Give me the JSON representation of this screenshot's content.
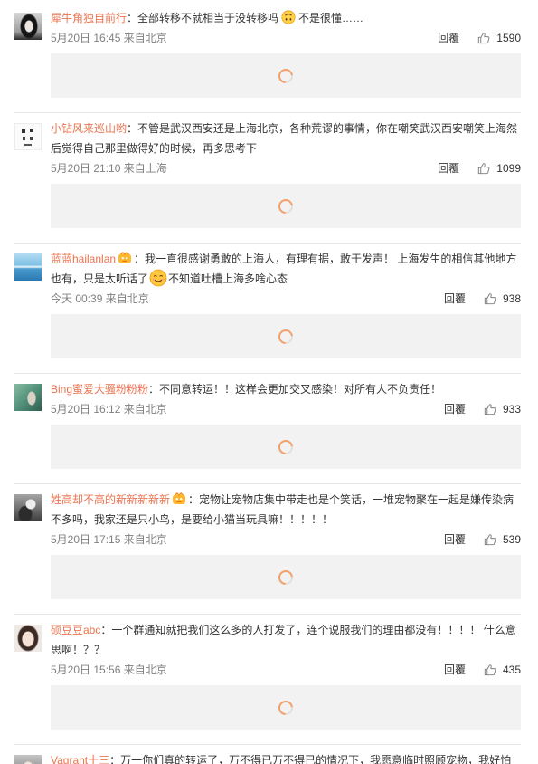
{
  "colors": {
    "username": "#eb7350",
    "text": "#333333",
    "meta": "#808080",
    "placeholder_bg": "#f2f2f2",
    "divider": "#e6e6e6",
    "spinner": "#f4a06a"
  },
  "labels": {
    "reply": "回覆"
  },
  "comments": [
    {
      "user": "犀牛角独自前行",
      "content": [
        {
          "text": "：全部转移不就相当于没转移吗"
        },
        {
          "emoji": "upside-down-face-icon"
        },
        {
          "text": "不是很懂……"
        }
      ],
      "time": "5月20日 16:45 来自北京",
      "likes": "1590"
    },
    {
      "user": "小钻风来巡山哟",
      "content": [
        {
          "text": "：不管是武汉西安还是上海北京，各种荒谬的事情，你在嘲笑武汉西安嘲笑上海然后觉得自己那里做得好的时候，再多思考下"
        }
      ],
      "time": "5月20日 21:10 来自上海",
      "likes": "1099"
    },
    {
      "user": "蓝蓝hailanlan",
      "badge": "member-badge-icon",
      "content": [
        {
          "text": "：我一直很感谢勇敢的上海人，有理有据，敢于发声！ 上海发生的相信其他地方也有，只是太听话了"
        },
        {
          "emoji": "smiling-face-icon"
        },
        {
          "text": "不知道吐槽上海多啥心态"
        }
      ],
      "time": "今天 00:39 来自北京",
      "likes": "938"
    },
    {
      "user": "Bing蜜爱大骚粉粉粉",
      "content": [
        {
          "text": "：不同意转运！！这样会更加交叉感染！对所有人不负责任！"
        }
      ],
      "time": "5月20日 16:12 来自北京",
      "likes": "933"
    },
    {
      "user": "姓高却不高的新新新新新",
      "badge": "member-badge-icon",
      "content": [
        {
          "text": "：宠物让宠物店集中带走也是个笑话，一堆宠物聚在一起是嫌传染病不多吗，我家还是只小鸟，是要给小猫当玩具嘛！！！！！"
        }
      ],
      "time": "5月20日 17:15 来自北京",
      "likes": "539"
    },
    {
      "user": "硕豆豆abc",
      "content": [
        {
          "text": "：一个群通知就把我们这么多的人打发了，连个说服我们的理由都没有！！！！ 什么意思啊！？？"
        }
      ],
      "time": "5月20日 15:56 来自北京",
      "likes": "435"
    },
    {
      "user": "Vagrant十三",
      "content": [
        {
          "text": "：万一你们真的转运了，万不得已万不得已的情况下，我愿意临时照顾宠物，我好怕"
        }
      ]
    }
  ]
}
